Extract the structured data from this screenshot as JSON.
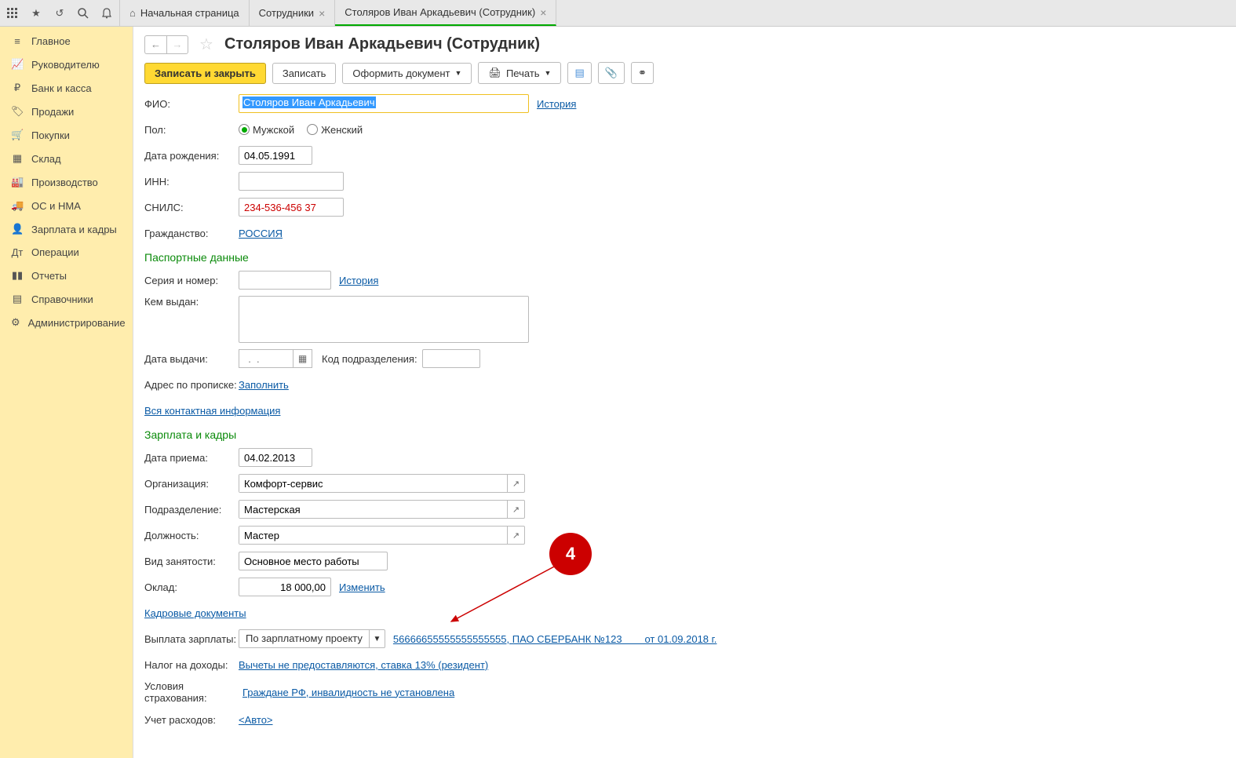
{
  "tabs": {
    "home": "Начальная страница",
    "employees": "Сотрудники",
    "current": "Столяров Иван Аркадьевич (Сотрудник)"
  },
  "sidebar": {
    "items": [
      {
        "label": "Главное"
      },
      {
        "label": "Руководителю"
      },
      {
        "label": "Банк и касса"
      },
      {
        "label": "Продажи"
      },
      {
        "label": "Покупки"
      },
      {
        "label": "Склад"
      },
      {
        "label": "Производство"
      },
      {
        "label": "ОС и НМА"
      },
      {
        "label": "Зарплата и кадры"
      },
      {
        "label": "Операции"
      },
      {
        "label": "Отчеты"
      },
      {
        "label": "Справочники"
      },
      {
        "label": "Администрирование"
      }
    ]
  },
  "page": {
    "title": "Столяров Иван Аркадьевич (Сотрудник)"
  },
  "toolbar": {
    "save_close": "Записать и закрыть",
    "save": "Записать",
    "make_doc": "Оформить документ",
    "print": "Печать"
  },
  "form": {
    "fio_label": "ФИО:",
    "fio_value": "Столяров Иван Аркадьевич",
    "history_link": "История",
    "gender_label": "Пол:",
    "gender_male": "Мужской",
    "gender_female": "Женский",
    "dob_label": "Дата рождения:",
    "dob_value": "04.05.1991",
    "inn_label": "ИНН:",
    "snils_label": "СНИЛС:",
    "snils_value": "234-536-456 37",
    "citizenship_label": "Гражданство:",
    "citizenship_value": "РОССИЯ"
  },
  "passport": {
    "title": "Паспортные данные",
    "series_label": "Серия и номер:",
    "history_link": "История",
    "issued_by_label": "Кем выдан:",
    "issue_date_label": "Дата выдачи:",
    "issue_date_placeholder": "  .  .",
    "dept_code_label": "Код подразделения:",
    "address_label": "Адрес по прописке:",
    "fill_link": "Заполнить",
    "contact_info_link": "Вся контактная информация"
  },
  "hr": {
    "title": "Зарплата и кадры",
    "hire_date_label": "Дата приема:",
    "hire_date_value": "04.02.2013",
    "org_label": "Организация:",
    "org_value": "Комфорт-сервис",
    "dept_label": "Подразделение:",
    "dept_value": "Мастерская",
    "position_label": "Должность:",
    "position_value": "Мастер",
    "employment_label": "Вид занятости:",
    "employment_value": "Основное место работы",
    "salary_label": "Оклад:",
    "salary_value": "18 000,00",
    "change_link": "Изменить",
    "hr_docs_link": "Кадровые документы",
    "payroll_label": "Выплата зарплаты:",
    "payroll_mode": "По зарплатному проекту",
    "payroll_account": "56666655555555555555, ПАО СБЕРБАНК №123        от 01.09.2018 г.",
    "tax_label": "Налог на доходы:",
    "tax_value": "Вычеты не предоставляются, ставка 13% (резидент)",
    "insurance_label": "Условия страхования:",
    "insurance_value": "Граждане РФ, инвалидность не установлена",
    "expense_label": "Учет расходов:",
    "expense_value": "<Авто>"
  },
  "annotation": {
    "marker": "4"
  }
}
